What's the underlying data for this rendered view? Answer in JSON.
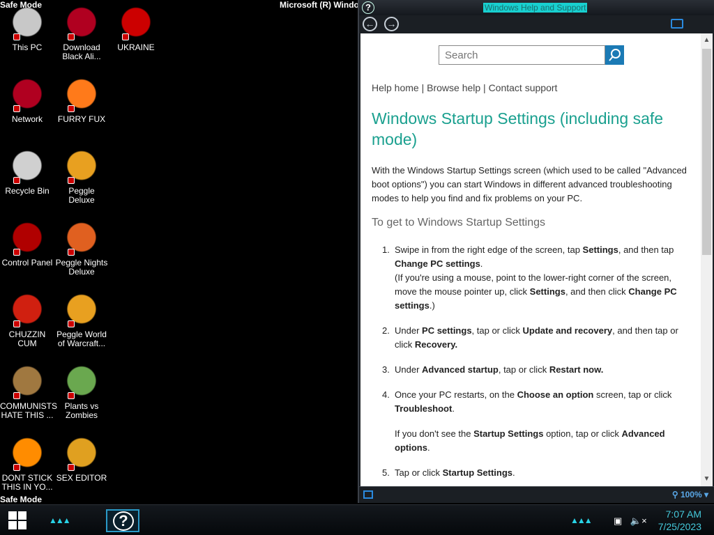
{
  "desktop": {
    "safe_mode_label": "Safe Mode",
    "os_title": "Microsoft (R) Windows",
    "icons": [
      {
        "label": "This PC",
        "icon": "this-pc-icon",
        "color": "#c8c8c8"
      },
      {
        "label": "Download Black Ali...",
        "icon": "download-icon",
        "color": "#b00020"
      },
      {
        "label": "UKRAINE",
        "icon": "radiation-icon",
        "color": "#cc0000"
      },
      {
        "label": "Network",
        "icon": "network-icon",
        "color": "#b00020"
      },
      {
        "label": "FURRY FUX",
        "icon": "firefox-icon",
        "color": "#ff7a1a"
      },
      {
        "label": "Recycle Bin",
        "icon": "recycle-bin-icon",
        "color": "#d0d0d0"
      },
      {
        "label": "Peggle Deluxe",
        "icon": "peggle-icon",
        "color": "#e8a020"
      },
      {
        "label": "Control Panel",
        "icon": "control-panel-icon",
        "color": "#b00000"
      },
      {
        "label": "Peggle Nights Deluxe",
        "icon": "peggle-nights-icon",
        "color": "#e06020"
      },
      {
        "label": "CHUZZIN CUM",
        "icon": "chuzzle-icon",
        "color": "#d02010"
      },
      {
        "label": "Peggle World of Warcraft...",
        "icon": "peggle-wow-icon",
        "color": "#e8a020"
      },
      {
        "label": "COMMUNISTS HATE THIS ...",
        "icon": "money-bag-icon",
        "color": "#a07840"
      },
      {
        "label": "Plants vs Zombies",
        "icon": "plants-vs-zombies-icon",
        "color": "#6aa84f"
      },
      {
        "label": "DONT STICK THIS IN YO...",
        "icon": "vlc-icon",
        "color": "#ff8c00"
      },
      {
        "label": "SEX EDITOR",
        "icon": "hxd-icon",
        "color": "#e0a020"
      }
    ]
  },
  "help_window": {
    "title": "Windows Help and Support",
    "search_placeholder": "Search",
    "links": "Help home | Browse help | Contact support",
    "heading": "Windows Startup Settings (including safe mode)",
    "intro": "With the Windows Startup Settings screen (which used to be called \"Advanced boot options\") you can start Windows in different advanced troubleshooting modes to help you find and fix problems on your PC.",
    "subheading": "To get to Windows Startup Settings",
    "steps": [
      {
        "num": "1.",
        "p1": [
          "Swipe in from the right edge of the screen, tap ",
          "Settings",
          ", and then tap ",
          "Change PC settings",
          "."
        ],
        "p2": [
          "(If you're using a mouse, point to the lower-right corner of the screen, move the mouse pointer up, click ",
          "Settings",
          ", and then click ",
          "Change PC settings",
          ".)"
        ]
      },
      {
        "num": "2.",
        "p1": [
          "Under ",
          "PC settings",
          ", tap or click ",
          "Update and recovery",
          ", and then tap or click ",
          "Recovery.",
          ""
        ]
      },
      {
        "num": "3.",
        "p1": [
          "Under ",
          "Advanced startup",
          ", tap or click ",
          "Restart now.",
          ""
        ]
      },
      {
        "num": "4.",
        "p1": [
          "Once your PC restarts, on the ",
          "Choose an option",
          " screen, tap or click ",
          "Troubleshoot",
          "."
        ],
        "p2": [
          "If you don't see the ",
          "Startup Settings",
          " option, tap or click ",
          "Advanced options",
          "."
        ]
      },
      {
        "num": "5.",
        "p1": [
          "Tap or click ",
          "Startup Settings",
          ".",
          "",
          ""
        ]
      }
    ],
    "zoom": "100%",
    "accent": "#1aa08f",
    "search_button_color": "#1b7ab5"
  },
  "taskbar": {
    "time": "7:07 AM",
    "date": "7/25/2023"
  }
}
